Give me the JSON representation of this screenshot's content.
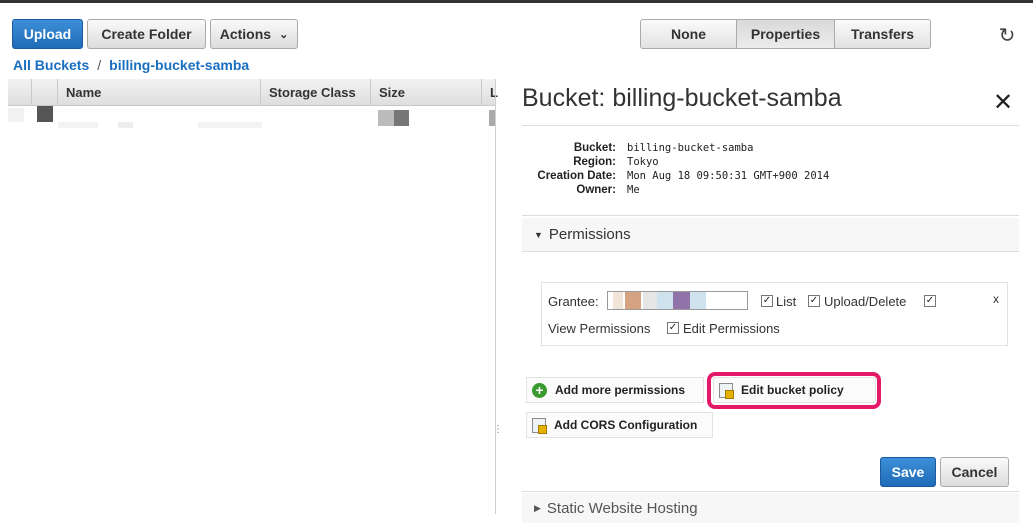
{
  "toolbar": {
    "upload_label": "Upload",
    "create_folder_label": "Create Folder",
    "actions_label": "Actions",
    "view_tabs": [
      "None",
      "Properties",
      "Transfers"
    ],
    "active_tab": "Properties"
  },
  "breadcrumb": {
    "root": "All Buckets",
    "separator": "/",
    "current": "billing-bucket-samba"
  },
  "table": {
    "columns": [
      "Name",
      "Storage Class",
      "Size",
      "L"
    ]
  },
  "panel": {
    "title": "Bucket: billing-bucket-samba",
    "close_glyph": "✕",
    "info_labels": [
      "Bucket:",
      "Region:",
      "Creation Date:",
      "Owner:"
    ],
    "info_values": [
      "billing-bucket-samba",
      "Tokyo",
      "Mon Aug 18 09:50:31 GMT+900 2014",
      "Me"
    ],
    "permissions": {
      "header": "Permissions",
      "grantee_label": "Grantee:",
      "list_label": "List",
      "upload_delete_label": "Upload/Delete",
      "view_permissions_label": "View Permissions",
      "edit_permissions_label": "Edit Permissions",
      "remove_label": "x"
    },
    "add_more_permissions": "Add more permissions",
    "edit_bucket_policy": "Edit bucket policy",
    "add_cors": "Add CORS Configuration",
    "save_label": "Save",
    "cancel_label": "Cancel",
    "static_hosting": "Static Website Hosting"
  },
  "colors": {
    "primary_button": "#2a7bc9",
    "link": "#1a6ec1",
    "highlight": "#e5196a",
    "add_icon": "#3b9a2f"
  }
}
